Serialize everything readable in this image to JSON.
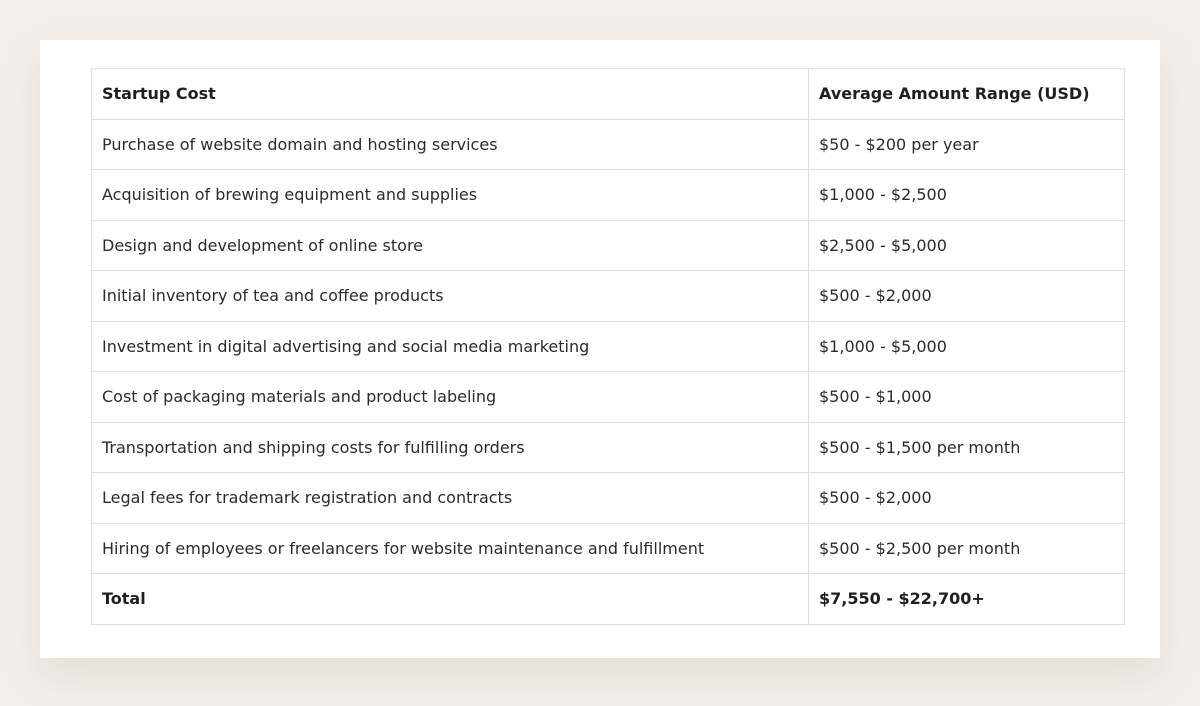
{
  "table": {
    "headers": [
      "Startup Cost",
      "Average Amount Range (USD)"
    ],
    "rows": [
      [
        "Purchase of website domain and hosting services",
        "$50 - $200 per year"
      ],
      [
        "Acquisition of brewing equipment and supplies",
        "$1,000 - $2,500"
      ],
      [
        "Design and development of online store",
        "$2,500 - $5,000"
      ],
      [
        "Initial inventory of tea and coffee products",
        "$500 - $2,000"
      ],
      [
        "Investment in digital advertising and social media marketing",
        "$1,000 - $5,000"
      ],
      [
        "Cost of packaging materials and product labeling",
        "$500 - $1,000"
      ],
      [
        "Transportation and shipping costs for fulfilling orders",
        "$500 - $1,500 per month"
      ],
      [
        "Legal fees for trademark registration and contracts",
        "$500 - $2,000"
      ],
      [
        "Hiring of employees or freelancers for website maintenance and fulfillment",
        "$500 - $2,500 per month"
      ]
    ],
    "total": [
      "Total",
      "$7,550 - $22,700+"
    ]
  }
}
